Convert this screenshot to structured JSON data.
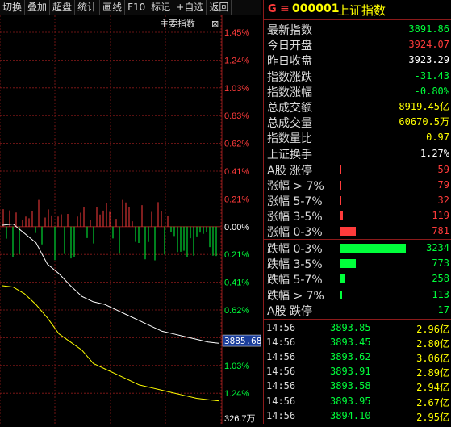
{
  "toolbar": {
    "buttons": [
      "切换",
      "叠加",
      "超盘",
      "统计",
      "画线",
      "F10",
      "标记",
      "+自选",
      "返回"
    ]
  },
  "chart": {
    "legend_label": "主要指数",
    "legend_close": "⊠",
    "y_labels_upper": [
      "1.45%",
      "1.24%",
      "1.03%",
      "0.83%",
      "0.62%",
      "0.41%",
      "0.21%",
      "0.00%",
      "0.21%",
      "0.41%",
      "0.62%",
      "0.83%",
      "1.03%",
      "1.24%"
    ],
    "current_price_tag": "3885.68",
    "volume_label": "326.7万",
    "colors": {
      "up": "#ff3b3b",
      "down": "#00ff3b",
      "neutral": "#ffffff",
      "grid": "#8b1a1a",
      "price_line": "#ffffff",
      "avg_line": "#ffff00"
    }
  },
  "chart_data": {
    "type": "line",
    "series": [
      {
        "name": "",
        "values": [
          0.01,
          0.02,
          -0.05,
          -0.12,
          -0.28,
          -0.35,
          -0.44,
          -0.52,
          -0.56,
          -0.58,
          -0.62,
          -0.66,
          -0.7,
          -0.74,
          -0.78,
          -0.8,
          -0.82,
          -0.84,
          -0.86,
          -0.87
        ]
      },
      {
        "name": "",
        "values": [
          -0.44,
          -0.45,
          -0.5,
          -0.58,
          -0.68,
          -0.8,
          -0.86,
          -0.92,
          -1.02,
          -1.06,
          -1.1,
          -1.14,
          -1.18,
          -1.2,
          -1.22,
          -1.24,
          -1.26,
          -1.28,
          -1.29,
          -1.3
        ]
      }
    ]
  },
  "quote": {
    "g_label": "G",
    "menu_icon": "≡",
    "code": "000001",
    "name": "上证指数",
    "rows": [
      {
        "label": "最新指数",
        "value": "3891.86",
        "color": "#00ff3b"
      },
      {
        "label": "今日开盘",
        "value": "3924.07",
        "color": "#ff3b3b"
      },
      {
        "label": "昨日收盘",
        "value": "3923.29",
        "color": "#ffffff"
      },
      {
        "label": "指数涨跌",
        "value": "-31.43",
        "color": "#00ff3b"
      },
      {
        "label": "指数涨幅",
        "value": "-0.80%",
        "color": "#00ff3b"
      },
      {
        "label": "总成交额",
        "value": "8919.45亿",
        "color": "#ffff00"
      },
      {
        "label": "总成交量",
        "value": "60670.5万",
        "color": "#ffff00"
      },
      {
        "label": "指数量比",
        "value": "0.97",
        "color": "#ffff00"
      },
      {
        "label": "上证换手",
        "value": "1.27%",
        "color": "#ffffff"
      }
    ]
  },
  "breadth": {
    "up": [
      {
        "label": "A股 涨停",
        "value": "59",
        "bar": 2
      },
      {
        "label": "涨幅 > 7%",
        "value": "79",
        "bar": 2
      },
      {
        "label": "涨幅 5-7%",
        "value": "32",
        "bar": 2
      },
      {
        "label": "涨幅 3-5%",
        "value": "119",
        "bar": 4
      },
      {
        "label": "涨幅 0-3%",
        "value": "781",
        "bar": 20
      }
    ],
    "down": [
      {
        "label": "跌幅 0-3%",
        "value": "3234",
        "bar": 82
      },
      {
        "label": "跌幅 3-5%",
        "value": "773",
        "bar": 20
      },
      {
        "label": "跌幅 5-7%",
        "value": "258",
        "bar": 7
      },
      {
        "label": "跌幅 > 7%",
        "value": "113",
        "bar": 3
      },
      {
        "label": "A股 跌停",
        "value": "17",
        "bar": 1
      }
    ]
  },
  "ticks": [
    {
      "time": "14:56",
      "price": "3893.85",
      "amount": "2.96亿"
    },
    {
      "time": "14:56",
      "price": "3893.45",
      "amount": "2.80亿"
    },
    {
      "time": "14:56",
      "price": "3893.62",
      "amount": "3.06亿"
    },
    {
      "time": "14:56",
      "price": "3893.91",
      "amount": "2.89亿"
    },
    {
      "time": "14:56",
      "price": "3893.58",
      "amount": "2.94亿"
    },
    {
      "time": "14:56",
      "price": "3893.95",
      "amount": "2.67亿"
    },
    {
      "time": "14:56",
      "price": "3894.10",
      "amount": "2.95亿"
    }
  ]
}
